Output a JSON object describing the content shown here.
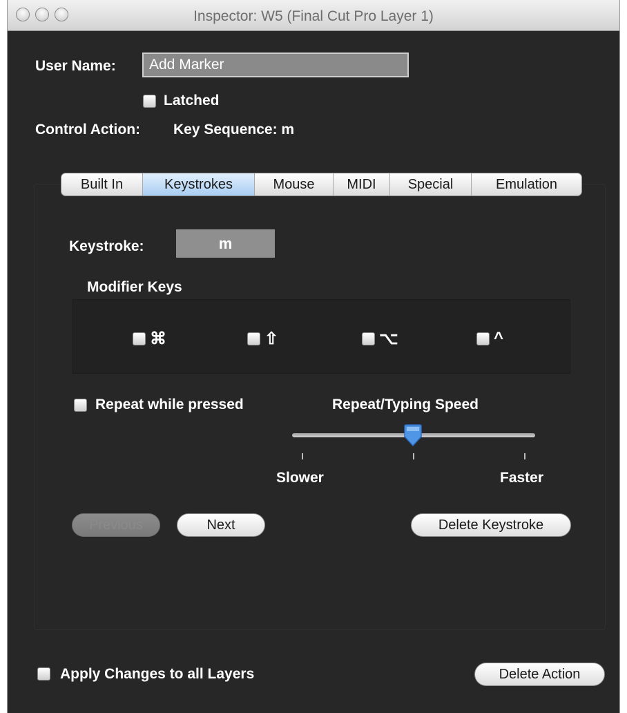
{
  "window": {
    "title": "Inspector: W5 (Final Cut Pro Layer 1)"
  },
  "user_name": {
    "label": "User Name:",
    "value": "Add Marker"
  },
  "latched": {
    "label": "Latched",
    "checked": false
  },
  "control_action": {
    "label": "Control Action:",
    "value": "Key Sequence: m"
  },
  "tabs": [
    {
      "label": "Built In",
      "active": false
    },
    {
      "label": "Keystrokes",
      "active": true
    },
    {
      "label": "Mouse",
      "active": false
    },
    {
      "label": "MIDI",
      "active": false
    },
    {
      "label": "Special",
      "active": false
    },
    {
      "label": "Emulation",
      "active": false
    }
  ],
  "keystroke": {
    "label": "Keystroke:",
    "value": "m"
  },
  "modifier_keys": {
    "label": "Modifier Keys",
    "keys": [
      {
        "symbol": "⌘",
        "checked": false
      },
      {
        "symbol": "⇧",
        "checked": false
      },
      {
        "symbol": "⌥",
        "checked": false
      },
      {
        "symbol": "^",
        "checked": false
      }
    ]
  },
  "repeat": {
    "label": "Repeat while pressed",
    "checked": false
  },
  "speed": {
    "label": "Repeat/Typing Speed",
    "min_label": "Slower",
    "max_label": "Faster",
    "value": 0.5
  },
  "buttons": {
    "previous": "Previous",
    "next": "Next",
    "delete_keystroke": "Delete Keystroke",
    "delete_action": "Delete Action"
  },
  "apply_all": {
    "label": "Apply Changes to all Layers",
    "checked": false
  },
  "colors": {
    "background": "#272727",
    "accent": "#a9cdf2",
    "thumb": "#4f97e6"
  }
}
